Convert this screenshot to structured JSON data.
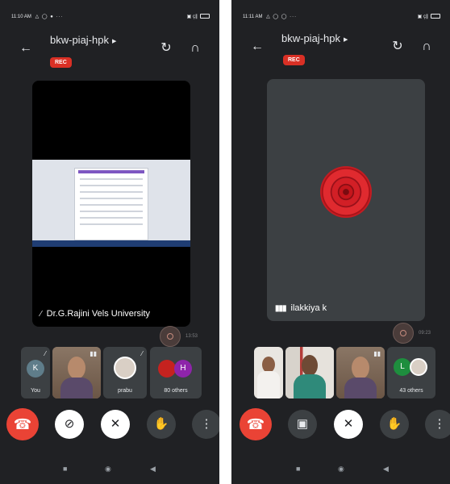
{
  "colors": {
    "background": "#202124",
    "tile": "#3c4043",
    "rec": "#d93025",
    "end_call": "#ea4335"
  },
  "left": {
    "status": {
      "time": "11:10 AM",
      "dots": "△ ◯ ● ···",
      "signal": "▣ ç∥"
    },
    "header": {
      "meeting_code": "bkw-piaj-hpk",
      "rec": "REC",
      "back_icon": "arrow-left-icon",
      "switch_camera_icon": "camera-flip-icon",
      "audio_icon": "headphones-icon"
    },
    "main_tile": {
      "presenter_label": "Dr.G.Rajini Vels University"
    },
    "self_time": "13:53",
    "participants": [
      {
        "name": "You",
        "initial": "K",
        "avatar_color": "#5f7d8a"
      },
      {
        "name": "",
        "kind": "video"
      },
      {
        "name": "prabu",
        "kind": "photo"
      },
      {
        "name": "80 others",
        "initial_a": "",
        "initial_b": "H",
        "color_a": "#c5221f",
        "color_b": "#8e24aa"
      }
    ]
  },
  "right": {
    "status": {
      "time": "11:11 AM",
      "dots": "△ ◯ ◯ ···",
      "signal": "▣ ç∥"
    },
    "header": {
      "meeting_code": "bkw-piaj-hpk",
      "rec": "REC",
      "back_icon": "arrow-left-icon",
      "switch_camera_icon": "camera-flip-icon",
      "audio_icon": "headphones-icon"
    },
    "main_tile": {
      "speaker_label": "ilakkiya k"
    },
    "self_time": "09:23",
    "participants": [
      {
        "name": "",
        "kind": "video"
      },
      {
        "name": "",
        "kind": "video"
      },
      {
        "name": "",
        "kind": "video"
      },
      {
        "name": "43 others",
        "initial_a": "L",
        "color_a": "#1e8e3e"
      }
    ]
  },
  "icons": {
    "end_call": "☎",
    "camera_off": "⊘",
    "camera_on": "▣",
    "mic_off": "✕",
    "raise_hand": "✋",
    "more": "⋮",
    "nav_square": "■",
    "nav_circle": "◉",
    "nav_back": "◀",
    "back": "←",
    "switch_cam": "↻",
    "headphones": "∩"
  }
}
